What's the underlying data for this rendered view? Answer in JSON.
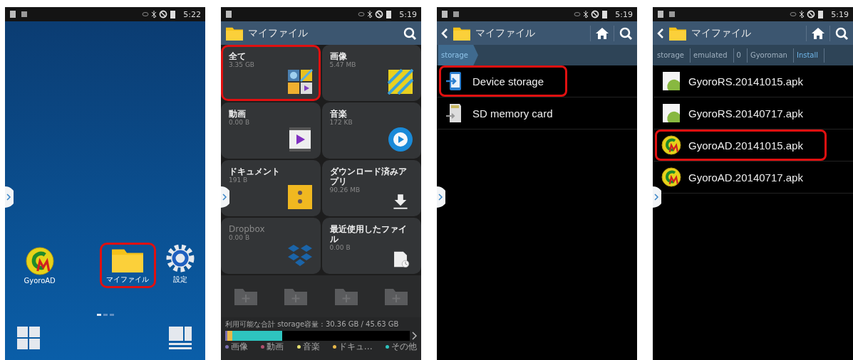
{
  "panels": [
    {
      "kind": "home",
      "status_bar": {
        "time": "5:22"
      },
      "apps": [
        {
          "kind": "gyoro",
          "label": "GyoroAD",
          "highlighted": false
        },
        {
          "kind": "folder",
          "label": "マイファイル",
          "highlighted": true
        },
        {
          "kind": "gear",
          "label": "設定",
          "highlighted": false
        }
      ],
      "page_dots": [
        {
          "selected": true
        },
        {
          "selected": false
        },
        {
          "selected": false
        }
      ]
    },
    {
      "kind": "categories",
      "status_bar": {
        "time": "5:19"
      },
      "header": {
        "title": "マイファイル"
      },
      "tiles": [
        {
          "kind": "all",
          "label": "全て",
          "size": "3.35 GB",
          "highlighted": true,
          "disabled": false
        },
        {
          "kind": "images",
          "label": "画像",
          "size": "5.47 MB",
          "highlighted": false,
          "disabled": false
        },
        {
          "kind": "video",
          "label": "動画",
          "size": "0.00 B",
          "highlighted": false,
          "disabled": false
        },
        {
          "kind": "music",
          "label": "音楽",
          "size": "172 KB",
          "highlighted": false,
          "disabled": false
        },
        {
          "kind": "documents",
          "label": "ドキュメント",
          "size": "191 B",
          "highlighted": false,
          "disabled": false
        },
        {
          "kind": "downloads",
          "label": "ダウンロード済みアプリ",
          "size": "90.26 MB",
          "highlighted": false,
          "disabled": false
        },
        {
          "kind": "dropbox",
          "label": "Dropbox",
          "size": "0.00 B",
          "highlighted": false,
          "disabled": true
        },
        {
          "kind": "recent",
          "label": "最近使用したファイル",
          "size": "0.00 B",
          "highlighted": false,
          "disabled": false
        }
      ],
      "shortcut_slots": [
        {
          "kind": "add"
        },
        {
          "kind": "add"
        },
        {
          "kind": "add"
        },
        {
          "kind": "add"
        }
      ],
      "storage": {
        "label": "利用可能な合計 storage容量 : 30.36 GB / 45.63 GB",
        "segments": [
          {
            "color": "#7b6fb0",
            "level": 0.01
          },
          {
            "color": "#e8b84a",
            "level": 0.04
          },
          {
            "color": "#2ec4bf",
            "level": 0.31
          }
        ],
        "legend": [
          {
            "label": "画像",
            "color": "#7b6fb0"
          },
          {
            "label": "動画",
            "color": "#b0506e"
          },
          {
            "label": "音楽",
            "color": "#e6e070"
          },
          {
            "label": "ドキュ…",
            "color": "#e8b84a"
          },
          {
            "label": "その他",
            "color": "#2ec4bf"
          }
        ]
      }
    },
    {
      "kind": "list",
      "status_bar": {
        "time": "5:19"
      },
      "header": {
        "title": "マイファイル"
      },
      "breadcrumbs": [
        {
          "label": "storage",
          "selected": true
        }
      ],
      "rows": [
        {
          "kind": "device",
          "label": "Device storage",
          "highlighted": true
        },
        {
          "kind": "sd",
          "label": "SD memory card",
          "highlighted": false
        }
      ]
    },
    {
      "kind": "list",
      "status_bar": {
        "time": "5:19"
      },
      "header": {
        "title": "マイファイル"
      },
      "breadcrumbs": [
        {
          "label": "storage",
          "selected": false
        },
        {
          "label": "emulated",
          "selected": false
        },
        {
          "label": "0",
          "selected": false
        },
        {
          "label": "Gyoroman",
          "selected": false
        },
        {
          "label": "Install",
          "selected": true
        }
      ],
      "rows": [
        {
          "kind": "apk",
          "label": "GyoroRS.20141015.apk",
          "highlighted": false
        },
        {
          "kind": "apk",
          "label": "GyoroRS.20140717.apk",
          "highlighted": false
        },
        {
          "kind": "gyoro",
          "label": "GyoroAD.20141015.apk",
          "highlighted": true
        },
        {
          "kind": "gyoro",
          "label": "GyoroAD.20140717.apk",
          "highlighted": false
        }
      ]
    }
  ]
}
